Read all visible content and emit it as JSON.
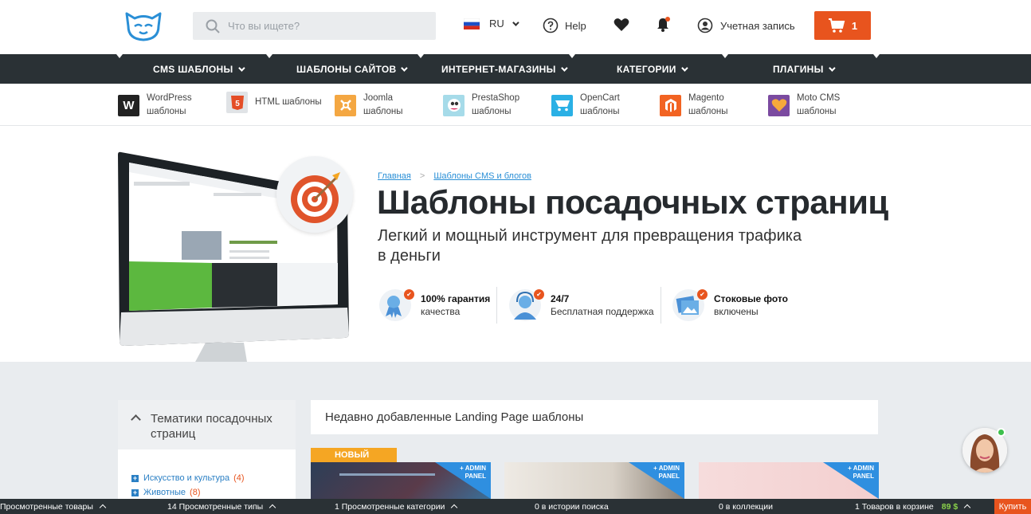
{
  "header": {
    "search_placeholder": "Что вы ищете?",
    "lang": "RU",
    "help": "Help",
    "account": "Учетная запись",
    "cart_count": "1"
  },
  "mainnav": [
    {
      "label": "CMS ШАБЛОНЫ"
    },
    {
      "label": "ШАБЛОНЫ САЙТОВ"
    },
    {
      "label": "ИНТЕРНЕТ-МАГАЗИНЫ"
    },
    {
      "label": "КАТЕГОРИИ"
    },
    {
      "label": "ПЛАГИНЫ"
    }
  ],
  "cms": [
    {
      "line1": "WordPress",
      "line2": "шаблоны",
      "icon": "wordpress-icon",
      "color": "#222222"
    },
    {
      "line1": "HTML шаблоны",
      "line2": "",
      "icon": "html5-icon",
      "color": "#e44d26"
    },
    {
      "line1": "Joomla",
      "line2": "шаблоны",
      "icon": "joomla-icon",
      "color": "#f4a742"
    },
    {
      "line1": "PrestaShop",
      "line2": "шаблоны",
      "icon": "prestashop-icon",
      "color": "#7fc8e0"
    },
    {
      "line1": "OpenCart",
      "line2": "шаблоны",
      "icon": "opencart-icon",
      "color": "#2ab0e5"
    },
    {
      "line1": "Magento",
      "line2": "шаблоны",
      "icon": "magento-icon",
      "color": "#f26322"
    },
    {
      "line1": "Moto CMS",
      "line2": "шаблоны",
      "icon": "motocms-icon",
      "color": "#7b4aa0"
    }
  ],
  "hero": {
    "breadcrumb": [
      "Главная",
      "Шаблоны CMS и блогов"
    ],
    "title": "Шаблоны посадочных страниц",
    "subtitle": "Легкий и мощный инструмент для превращения трафика в деньги",
    "features": [
      {
        "bold": "100% гарантия",
        "sub": "качества",
        "icon": "award-ribbon-icon"
      },
      {
        "bold": "24/7",
        "sub": "Бесплатная поддержка",
        "icon": "support-agent-icon"
      },
      {
        "bold": "Стоковые фото",
        "sub": "включены",
        "icon": "stock-photos-icon"
      }
    ]
  },
  "sidebar": {
    "heading": "Тематики посадочных страниц",
    "filters": [
      {
        "label": "Искусство и культура",
        "count": "(4)"
      },
      {
        "label": "Животные",
        "count": "(8)"
      }
    ]
  },
  "recent": {
    "heading": "Недавно добавленные Landing Page шаблоны",
    "new_tag": "НОВЫЙ",
    "admin_badge_line1": "+ ADMIN",
    "admin_badge_line2": "PANEL"
  },
  "bottombar": {
    "viewed_products": "Просмотренные товары",
    "viewed_types": "14 Просмотренные типы",
    "viewed_categories": "1 Просмотренные категории",
    "search_history": "0 в истории поиска",
    "collections": "0 в коллекции",
    "cart_items": "1 Товаров в корзине",
    "cart_price": "89 $",
    "buy": "Купить"
  }
}
